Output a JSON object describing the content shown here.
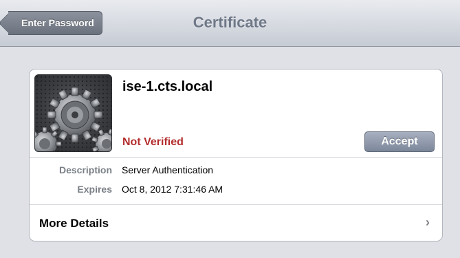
{
  "navbar": {
    "back_label": "Enter Password",
    "title": "Certificate"
  },
  "certificate": {
    "icon": "gears-icon",
    "name": "ise-1.cts.local",
    "status": "Not Verified",
    "status_color": "#b32c2c",
    "accept_label": "Accept",
    "details": [
      {
        "label": "Description",
        "value": "Server Authentication"
      },
      {
        "label": "Expires",
        "value": "Oct 8, 2012 7:31:46 AM"
      }
    ],
    "more_details_label": "More Details",
    "more_details_icon": "chevron-right-icon"
  }
}
